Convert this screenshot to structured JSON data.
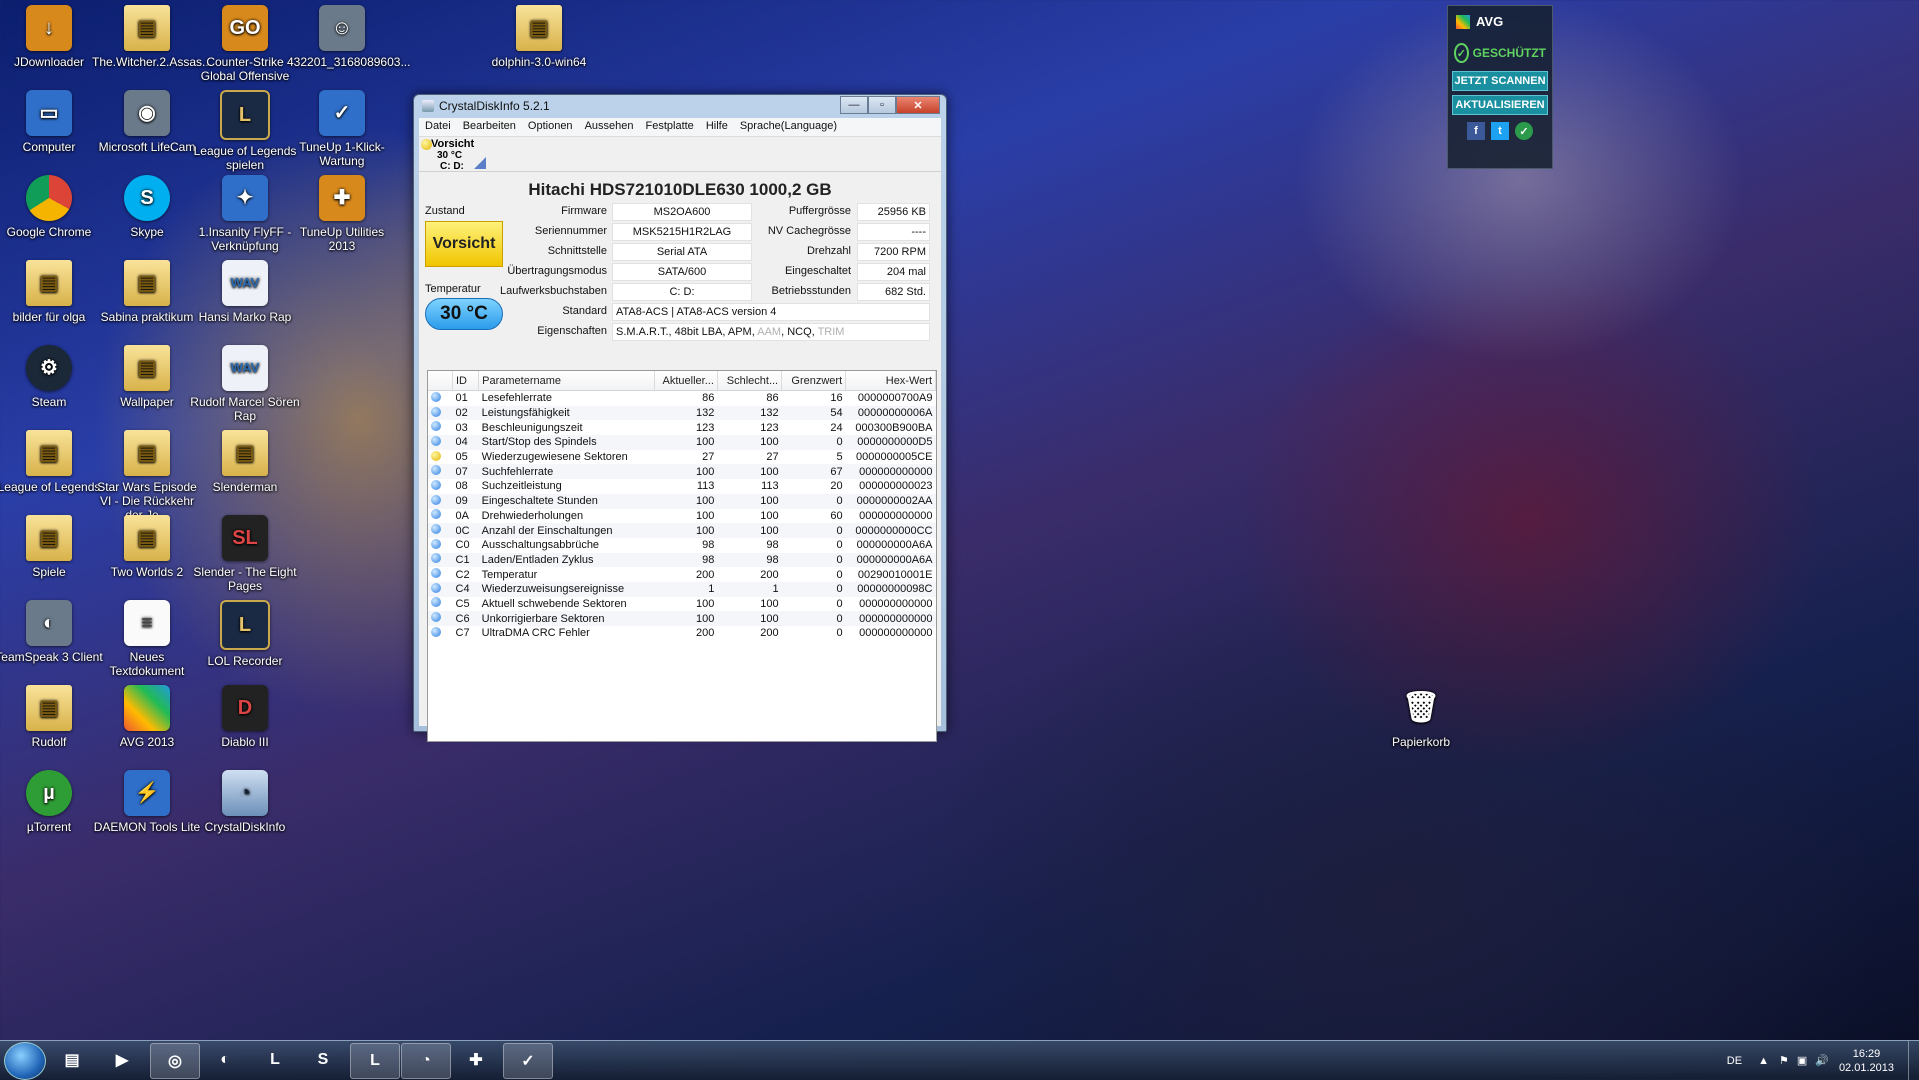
{
  "desktop_icons": [
    {
      "label": "JDownloader",
      "icon": "jdownloader-icon",
      "cls": "orange",
      "glyph": "↓"
    },
    {
      "label": "The.Witcher.2.Assas...",
      "icon": "folder-icon",
      "cls": "folder",
      "glyph": "▤"
    },
    {
      "label": "Counter-Strike Global Offensive",
      "icon": "csgo-icon",
      "cls": "orange",
      "glyph": "GO"
    },
    {
      "label": "432201_3168089603...",
      "icon": "image-icon",
      "cls": "gray",
      "glyph": "☺"
    },
    {
      "label": "dolphin-3.0-win64",
      "icon": "folder-icon",
      "cls": "folder",
      "glyph": "▤"
    },
    {
      "label": "Computer",
      "icon": "computer-icon",
      "cls": "blue",
      "glyph": "▭"
    },
    {
      "label": "Microsoft LifeCam",
      "icon": "webcam-icon",
      "cls": "gray",
      "glyph": "◉"
    },
    {
      "label": "League of Legends spielen",
      "icon": "lol-icon",
      "cls": "lol",
      "glyph": "L"
    },
    {
      "label": "TuneUp 1-Klick-Wartung",
      "icon": "tuneup-icon",
      "cls": "blue",
      "glyph": "✓"
    },
    {
      "label": "Google Chrome",
      "icon": "chrome-icon",
      "cls": "chrome",
      "glyph": ""
    },
    {
      "label": "Skype",
      "icon": "skype-icon",
      "cls": "skype",
      "glyph": "S"
    },
    {
      "label": "1.Insanity FlyFF - Verknüpfung",
      "icon": "flyff-icon",
      "cls": "blue",
      "glyph": "✦"
    },
    {
      "label": "TuneUp Utilities 2013",
      "icon": "tuneup-utilities-icon",
      "cls": "orange",
      "glyph": "✚"
    },
    {
      "label": "bilder für olga",
      "icon": "folder-icon",
      "cls": "folder",
      "glyph": "▤"
    },
    {
      "label": "Sabina praktikum",
      "icon": "folder-icon",
      "cls": "folder",
      "glyph": "▤"
    },
    {
      "label": "Hansi Marko Rap",
      "icon": "wav-file-icon",
      "cls": "wav",
      "glyph": "WAV"
    },
    {
      "label": "Steam",
      "icon": "steam-icon",
      "cls": "steam",
      "glyph": "⚙"
    },
    {
      "label": "Wallpaper",
      "icon": "folder-icon",
      "cls": "folder",
      "glyph": "▤"
    },
    {
      "label": "Rudolf Marcel Sören Rap",
      "icon": "wav-file-icon",
      "cls": "wav",
      "glyph": "WAV"
    },
    {
      "label": "League of Legends",
      "icon": "folder-icon",
      "cls": "folder",
      "glyph": "▤"
    },
    {
      "label": "Star Wars Episode VI - Die Rückkehr der Je...",
      "icon": "folder-icon",
      "cls": "folder",
      "glyph": "▤"
    },
    {
      "label": "Slenderman",
      "icon": "folder-icon",
      "cls": "folder",
      "glyph": "▤"
    },
    {
      "label": "Spiele",
      "icon": "folder-icon",
      "cls": "folder",
      "glyph": "▤"
    },
    {
      "label": "Two Worlds 2",
      "icon": "folder-icon",
      "cls": "folder",
      "glyph": "▤"
    },
    {
      "label": "Slender - The Eight Pages",
      "icon": "slender-icon",
      "cls": "dark",
      "glyph": "SL"
    },
    {
      "label": "TeamSpeak 3 Client",
      "icon": "teamspeak-icon",
      "cls": "gray",
      "glyph": "◐"
    },
    {
      "label": "Neues Textdokument",
      "icon": "text-document-icon",
      "cls": "doc",
      "glyph": "≡"
    },
    {
      "label": "LOL Recorder",
      "icon": "lol-recorder-icon",
      "cls": "lol",
      "glyph": "L"
    },
    {
      "label": "Rudolf",
      "icon": "user-folder-icon",
      "cls": "folder",
      "glyph": "▤"
    },
    {
      "label": "AVG 2013",
      "icon": "avg-icon",
      "cls": "avg",
      "glyph": ""
    },
    {
      "label": "Diablo III",
      "icon": "diablo-icon",
      "cls": "dark",
      "glyph": "D"
    },
    {
      "label": "µTorrent",
      "icon": "utorrent-icon",
      "cls": "green",
      "glyph": "µ"
    },
    {
      "label": "DAEMON Tools Lite",
      "icon": "daemon-tools-icon",
      "cls": "blue",
      "glyph": "⚡"
    },
    {
      "label": "CrystalDiskInfo",
      "icon": "crystaldiskinfo-icon",
      "cls": "cdi",
      "glyph": "◔"
    },
    {
      "label": "Papierkorb",
      "icon": "recycle-bin-icon",
      "cls": "recycle",
      "glyph": "🗑"
    }
  ],
  "avg": {
    "brand": "AVG",
    "status": "GESCHÜTZT",
    "scan_button": "JETZT SCANNEN",
    "update_button": "AKTUALISIEREN",
    "social": [
      "f",
      "t",
      "✓"
    ]
  },
  "window": {
    "title": "CrystalDiskInfo 5.2.1",
    "minimize": "—",
    "maximize": "▫",
    "close": "✕",
    "menu": [
      "Datei",
      "Bearbeiten",
      "Optionen",
      "Aussehen",
      "Festplatte",
      "Hilfe",
      "Sprache(Language)"
    ],
    "disk_tab": {
      "status": "Vorsicht",
      "temp": "30 °C",
      "drives": "C: D:"
    },
    "model": "Hitachi HDS721010DLE630  1000,2 GB",
    "labels": {
      "zustand": "Zustand",
      "temperatur": "Temperatur",
      "firmware": "Firmware",
      "serial": "Seriennummer",
      "interface": "Schnittstelle",
      "transfer": "Übertragungsmodus",
      "letters": "Laufwerksbuchstaben",
      "standard": "Standard",
      "features": "Eigenschaften",
      "buffer": "Puffergrösse",
      "nvcache": "NV Cachegrösse",
      "rpm": "Drehzahl",
      "powercount": "Eingeschaltet",
      "hours": "Betriebsstunden"
    },
    "values": {
      "health": "Vorsicht",
      "temperature": "30 °C",
      "firmware": "MS2OA600",
      "serial": "MSK5215H1R2LAG",
      "interface": "Serial ATA",
      "transfer": "SATA/600",
      "letters": "C: D:",
      "standard": "ATA8-ACS | ATA8-ACS version 4",
      "features_active": "S.M.A.R.T., 48bit LBA, APM,",
      "features_aam": "AAM",
      "features_ncq": ", NCQ,",
      "features_trim": "TRIM",
      "buffer": "25956 KB",
      "nvcache": "----",
      "rpm": "7200 RPM",
      "powercount": "204 mal",
      "hours": "682 Std."
    },
    "smart_headers": [
      "",
      "ID",
      "Parametername",
      "Aktueller...",
      "Schlecht...",
      "Grenzwert",
      "Hex-Wert"
    ],
    "smart_rows": [
      {
        "s": "good",
        "id": "01",
        "name": "Lesefehlerrate",
        "cur": "86",
        "worst": "86",
        "thr": "16",
        "raw": "0000000700A9"
      },
      {
        "s": "good",
        "id": "02",
        "name": "Leistungsfähigkeit",
        "cur": "132",
        "worst": "132",
        "thr": "54",
        "raw": "00000000006A"
      },
      {
        "s": "good",
        "id": "03",
        "name": "Beschleunigungszeit",
        "cur": "123",
        "worst": "123",
        "thr": "24",
        "raw": "000300B900BA"
      },
      {
        "s": "good",
        "id": "04",
        "name": "Start/Stop des Spindels",
        "cur": "100",
        "worst": "100",
        "thr": "0",
        "raw": "0000000000D5"
      },
      {
        "s": "warn",
        "id": "05",
        "name": "Wiederzugewiesene Sektoren",
        "cur": "27",
        "worst": "27",
        "thr": "5",
        "raw": "0000000005CE"
      },
      {
        "s": "good",
        "id": "07",
        "name": "Suchfehlerrate",
        "cur": "100",
        "worst": "100",
        "thr": "67",
        "raw": "000000000000"
      },
      {
        "s": "good",
        "id": "08",
        "name": "Suchzeitleistung",
        "cur": "113",
        "worst": "113",
        "thr": "20",
        "raw": "000000000023"
      },
      {
        "s": "good",
        "id": "09",
        "name": "Eingeschaltete Stunden",
        "cur": "100",
        "worst": "100",
        "thr": "0",
        "raw": "0000000002AA"
      },
      {
        "s": "good",
        "id": "0A",
        "name": "Drehwiederholungen",
        "cur": "100",
        "worst": "100",
        "thr": "60",
        "raw": "000000000000"
      },
      {
        "s": "good",
        "id": "0C",
        "name": "Anzahl der Einschaltungen",
        "cur": "100",
        "worst": "100",
        "thr": "0",
        "raw": "0000000000CC"
      },
      {
        "s": "good",
        "id": "C0",
        "name": "Ausschaltungsabbrüche",
        "cur": "98",
        "worst": "98",
        "thr": "0",
        "raw": "000000000A6A"
      },
      {
        "s": "good",
        "id": "C1",
        "name": "Laden/Entladen Zyklus",
        "cur": "98",
        "worst": "98",
        "thr": "0",
        "raw": "000000000A6A"
      },
      {
        "s": "good",
        "id": "C2",
        "name": "Temperatur",
        "cur": "200",
        "worst": "200",
        "thr": "0",
        "raw": "00290010001E"
      },
      {
        "s": "good",
        "id": "C4",
        "name": "Wiederzuweisungsereignisse",
        "cur": "1",
        "worst": "1",
        "thr": "0",
        "raw": "00000000098C"
      },
      {
        "s": "good",
        "id": "C5",
        "name": "Aktuell schwebende Sektoren",
        "cur": "100",
        "worst": "100",
        "thr": "0",
        "raw": "000000000000"
      },
      {
        "s": "good",
        "id": "C6",
        "name": "Unkorrigierbare Sektoren",
        "cur": "100",
        "worst": "100",
        "thr": "0",
        "raw": "000000000000"
      },
      {
        "s": "good",
        "id": "C7",
        "name": "UltraDMA CRC Fehler",
        "cur": "200",
        "worst": "200",
        "thr": "0",
        "raw": "000000000000"
      }
    ]
  },
  "taskbar": {
    "buttons": [
      {
        "name": "taskbar-explorer",
        "icon": "folder-icon",
        "glyph": "▤",
        "active": false
      },
      {
        "name": "taskbar-media-player",
        "icon": "media-player-icon",
        "glyph": "▶",
        "active": false
      },
      {
        "name": "taskbar-chrome",
        "icon": "chrome-icon",
        "glyph": "◎",
        "active": true
      },
      {
        "name": "taskbar-teamspeak",
        "icon": "teamspeak-icon",
        "glyph": "◐",
        "active": false
      },
      {
        "name": "taskbar-lol",
        "icon": "lol-icon",
        "glyph": "L",
        "active": false
      },
      {
        "name": "taskbar-skype",
        "icon": "skype-icon",
        "glyph": "S",
        "active": false
      },
      {
        "name": "taskbar-lol-launcher",
        "icon": "lol-icon",
        "glyph": "L",
        "active": true
      },
      {
        "name": "taskbar-crystaldiskinfo",
        "icon": "crystaldiskinfo-icon",
        "glyph": "◔",
        "active": true
      },
      {
        "name": "taskbar-tuneup",
        "icon": "tuneup-utilities-icon",
        "glyph": "✚",
        "active": false
      },
      {
        "name": "taskbar-tuneup-wartung",
        "icon": "tuneup-icon",
        "glyph": "✓",
        "active": true
      }
    ],
    "language": "DE",
    "time": "16:29",
    "date": "02.01.2013"
  }
}
